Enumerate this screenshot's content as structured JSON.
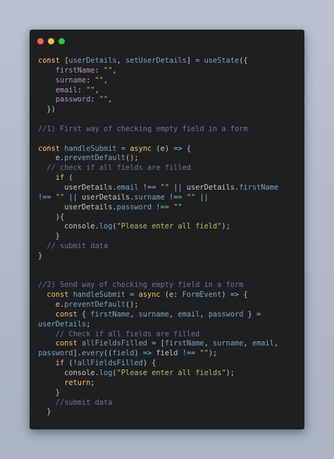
{
  "window": {
    "controls": [
      "close",
      "minimize",
      "maximize"
    ],
    "colors": {
      "close": "#ff5f56",
      "minimize": "#ffbd2e",
      "maximize": "#27c93f",
      "background": "#1d1f21"
    }
  },
  "code_lines": [
    [
      [
        "kw",
        "const "
      ],
      [
        "tx",
        "["
      ],
      [
        "fn",
        "userDetails"
      ],
      [
        "tx",
        ", "
      ],
      [
        "fn",
        "setUserDetails"
      ],
      [
        "tx",
        "] "
      ],
      [
        "op",
        "="
      ],
      [
        "tx",
        " "
      ],
      [
        "fn",
        "useState"
      ],
      [
        "tx",
        "({"
      ]
    ],
    [
      [
        "prop",
        "    firstName"
      ],
      [
        "tx",
        ": "
      ],
      [
        "str",
        "\"\""
      ],
      [
        "tx",
        ","
      ]
    ],
    [
      [
        "prop",
        "    surname"
      ],
      [
        "tx",
        ": "
      ],
      [
        "str",
        "\"\""
      ],
      [
        "tx",
        ","
      ]
    ],
    [
      [
        "prop",
        "    email"
      ],
      [
        "tx",
        ": "
      ],
      [
        "str",
        "\"\""
      ],
      [
        "tx",
        ","
      ]
    ],
    [
      [
        "prop",
        "    password"
      ],
      [
        "tx",
        ": "
      ],
      [
        "str",
        "\"\""
      ],
      [
        "tx",
        ","
      ]
    ],
    [
      [
        "tx",
        "  })"
      ]
    ],
    [],
    [
      [
        "cm",
        "//1) First way of checking empty field in a form"
      ]
    ],
    [],
    [
      [
        "kw",
        "const "
      ],
      [
        "fn",
        "handleSubmit"
      ],
      [
        "tx",
        " "
      ],
      [
        "op",
        "="
      ],
      [
        "tx",
        " "
      ],
      [
        "kw",
        "async"
      ],
      [
        "tx",
        " (e) "
      ],
      [
        "op",
        "=>"
      ],
      [
        "tx",
        " {"
      ]
    ],
    [
      [
        "tx",
        "    e."
      ],
      [
        "fn",
        "preventDefault"
      ],
      [
        "tx",
        "();"
      ]
    ],
    [
      [
        "cm",
        "  // check if all fields are filled"
      ]
    ],
    [
      [
        "kw",
        "    if"
      ],
      [
        "tx",
        " ("
      ]
    ],
    [
      [
        "tx",
        "      userDetails."
      ],
      [
        "fn",
        "email"
      ],
      [
        "tx",
        " "
      ],
      [
        "op",
        "!=="
      ],
      [
        "tx",
        " "
      ],
      [
        "str",
        "\"\""
      ],
      [
        "tx",
        " "
      ],
      [
        "op",
        "||"
      ],
      [
        "tx",
        " userDetails."
      ],
      [
        "fn",
        "firstName"
      ]
    ],
    [
      [
        "op",
        "!=="
      ],
      [
        "tx",
        " "
      ],
      [
        "str",
        "\"\""
      ],
      [
        "tx",
        " "
      ],
      [
        "op",
        "||"
      ],
      [
        "tx",
        " userDetails."
      ],
      [
        "fn",
        "surname"
      ],
      [
        "tx",
        " "
      ],
      [
        "op",
        "!=="
      ],
      [
        "tx",
        " "
      ],
      [
        "str",
        "\"\""
      ],
      [
        "tx",
        " "
      ],
      [
        "op",
        "||"
      ]
    ],
    [
      [
        "tx",
        "      userDetails."
      ],
      [
        "fn",
        "password"
      ],
      [
        "tx",
        " "
      ],
      [
        "op",
        "!=="
      ],
      [
        "tx",
        " "
      ],
      [
        "str",
        "\"\""
      ]
    ],
    [
      [
        "tx",
        "    ){"
      ]
    ],
    [
      [
        "tx",
        "      console."
      ],
      [
        "fn",
        "log"
      ],
      [
        "tx",
        "("
      ],
      [
        "str",
        "\"Please enter all field\""
      ],
      [
        "tx",
        ");"
      ]
    ],
    [
      [
        "tx",
        "    }"
      ]
    ],
    [
      [
        "cm",
        "  // submit data"
      ]
    ],
    [
      [
        "tx",
        "}"
      ]
    ],
    [],
    [],
    [
      [
        "cm",
        "//2) Send way of checking empty field in a form"
      ]
    ],
    [
      [
        "kw",
        "  const "
      ],
      [
        "fn",
        "handleSubmit"
      ],
      [
        "tx",
        " "
      ],
      [
        "op",
        "="
      ],
      [
        "tx",
        " "
      ],
      [
        "kw",
        "async"
      ],
      [
        "tx",
        " (e: "
      ],
      [
        "fn",
        "FormEvent"
      ],
      [
        "tx",
        ") "
      ],
      [
        "op",
        "=>"
      ],
      [
        "tx",
        " {"
      ]
    ],
    [
      [
        "tx",
        "    e."
      ],
      [
        "fn",
        "preventDefault"
      ],
      [
        "tx",
        "();"
      ]
    ],
    [
      [
        "kw",
        "    const"
      ],
      [
        "tx",
        " { "
      ],
      [
        "fn",
        "firstName"
      ],
      [
        "tx",
        ", "
      ],
      [
        "fn",
        "surname"
      ],
      [
        "tx",
        ", "
      ],
      [
        "fn",
        "email"
      ],
      [
        "tx",
        ", "
      ],
      [
        "fn",
        "password"
      ],
      [
        "tx",
        " } "
      ],
      [
        "op",
        "="
      ]
    ],
    [
      [
        "fn",
        "userDetails"
      ],
      [
        "tx",
        ";"
      ]
    ],
    [
      [
        "cm",
        "    // Check if all fields are filled"
      ]
    ],
    [
      [
        "kw",
        "    const"
      ],
      [
        "tx",
        " "
      ],
      [
        "fn",
        "allFieldsFilled"
      ],
      [
        "tx",
        " "
      ],
      [
        "op",
        "="
      ],
      [
        "tx",
        " ["
      ],
      [
        "fn",
        "firstName"
      ],
      [
        "tx",
        ", "
      ],
      [
        "fn",
        "surname"
      ],
      [
        "tx",
        ", "
      ],
      [
        "fn",
        "email"
      ],
      [
        "tx",
        ","
      ]
    ],
    [
      [
        "fn",
        "password"
      ],
      [
        "tx",
        "]."
      ],
      [
        "fn",
        "every"
      ],
      [
        "tx",
        "(("
      ],
      [
        "fn",
        "field"
      ],
      [
        "tx",
        ") "
      ],
      [
        "op",
        "=>"
      ],
      [
        "tx",
        " field "
      ],
      [
        "op",
        "!=="
      ],
      [
        "tx",
        " "
      ],
      [
        "str",
        "\"\""
      ],
      [
        "tx",
        ");"
      ]
    ],
    [
      [
        "kw",
        "    if"
      ],
      [
        "tx",
        " ("
      ],
      [
        "op",
        "!"
      ],
      [
        "fn",
        "allFieldsFilled"
      ],
      [
        "tx",
        ") {"
      ]
    ],
    [
      [
        "tx",
        "      console."
      ],
      [
        "fn",
        "log"
      ],
      [
        "tx",
        "("
      ],
      [
        "str",
        "\"Please enter all fields\""
      ],
      [
        "tx",
        ");"
      ]
    ],
    [
      [
        "kw",
        "      return"
      ],
      [
        "tx",
        ";"
      ]
    ],
    [
      [
        "tx",
        "    }"
      ]
    ],
    [
      [
        "cm",
        "    //submit data"
      ]
    ],
    [
      [
        "tx",
        "  }"
      ]
    ]
  ]
}
